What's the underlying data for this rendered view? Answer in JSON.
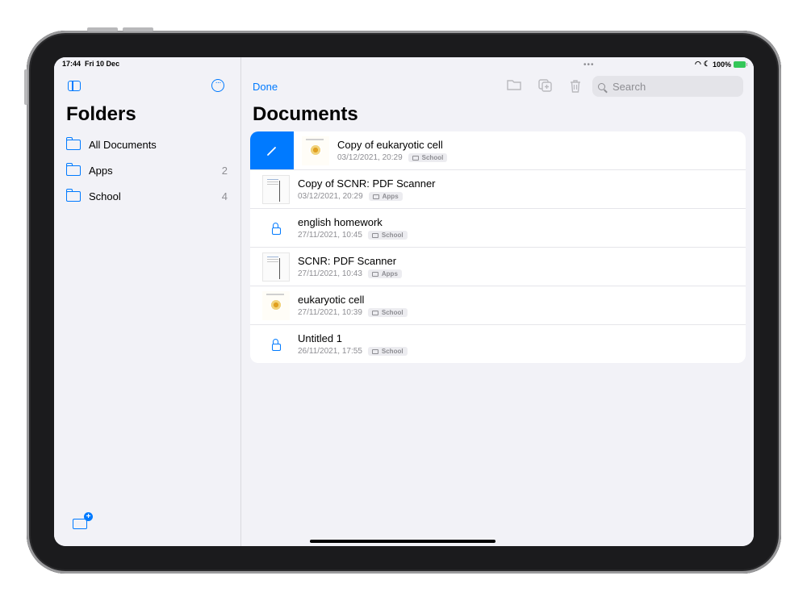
{
  "status": {
    "time": "17:44",
    "date": "Fri 10 Dec",
    "battery": "100%"
  },
  "sidebar": {
    "title": "Folders",
    "folders": [
      {
        "name": "All Documents",
        "count": ""
      },
      {
        "name": "Apps",
        "count": "2"
      },
      {
        "name": "School",
        "count": "4"
      }
    ]
  },
  "toolbar": {
    "done_label": "Done",
    "search_placeholder": "Search"
  },
  "main": {
    "title": "Documents",
    "documents": [
      {
        "title": "Copy of eukaryotic cell",
        "date": "03/12/2021, 20:29",
        "folder": "School",
        "thumbnail": "cell-diagram"
      },
      {
        "title": "Copy of SCNR: PDF Scanner",
        "date": "03/12/2021, 20:29",
        "folder": "Apps",
        "thumbnail": "document"
      },
      {
        "title": "english homework",
        "date": "27/11/2021, 10:45",
        "folder": "School",
        "thumbnail": "lock-icon"
      },
      {
        "title": "SCNR: PDF Scanner",
        "date": "27/11/2021, 10:43",
        "folder": "Apps",
        "thumbnail": "document"
      },
      {
        "title": "eukaryotic cell",
        "date": "27/11/2021, 10:39",
        "folder": "School",
        "thumbnail": "cell-diagram"
      },
      {
        "title": "Untitled 1",
        "date": "26/11/2021, 17:55",
        "folder": "School",
        "thumbnail": "lock-icon"
      }
    ]
  },
  "colors": {
    "accent": "#007aff",
    "background": "#f2f2f7",
    "battery": "#34c759"
  }
}
